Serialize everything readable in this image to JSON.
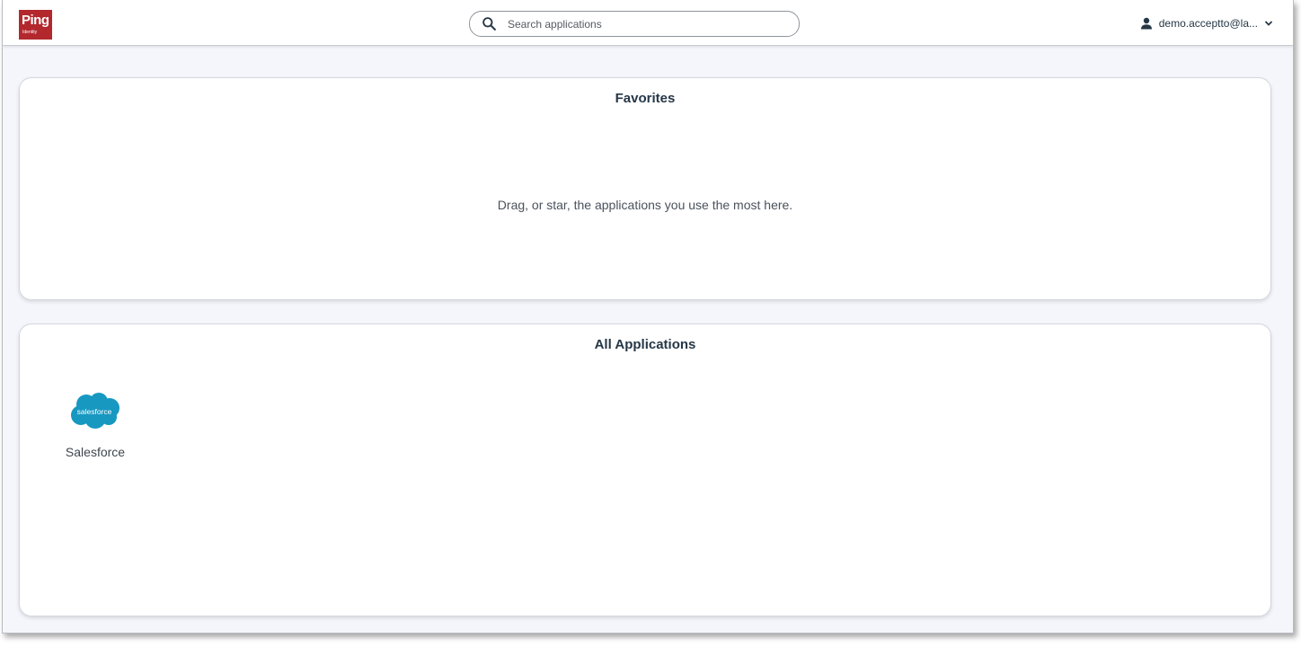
{
  "header": {
    "logo_brand": "Ping",
    "logo_sub": "Identity",
    "search_placeholder": "Search applications",
    "user_name": "demo.acceptto@la...",
    "icons": [
      "search-icon",
      "user-icon",
      "chevron-down-icon"
    ]
  },
  "favorites": {
    "title": "Favorites",
    "empty_message": "Drag, or star, the applications you use the most here."
  },
  "all_apps": {
    "title": "All Applications",
    "apps": [
      {
        "name": "Salesforce",
        "logo_text": "salesforce",
        "logo_color": "#1798c1"
      }
    ]
  },
  "colors": {
    "brand_red": "#b3282d",
    "text_dark": "#253746",
    "page_bg": "#f5f6fb"
  }
}
